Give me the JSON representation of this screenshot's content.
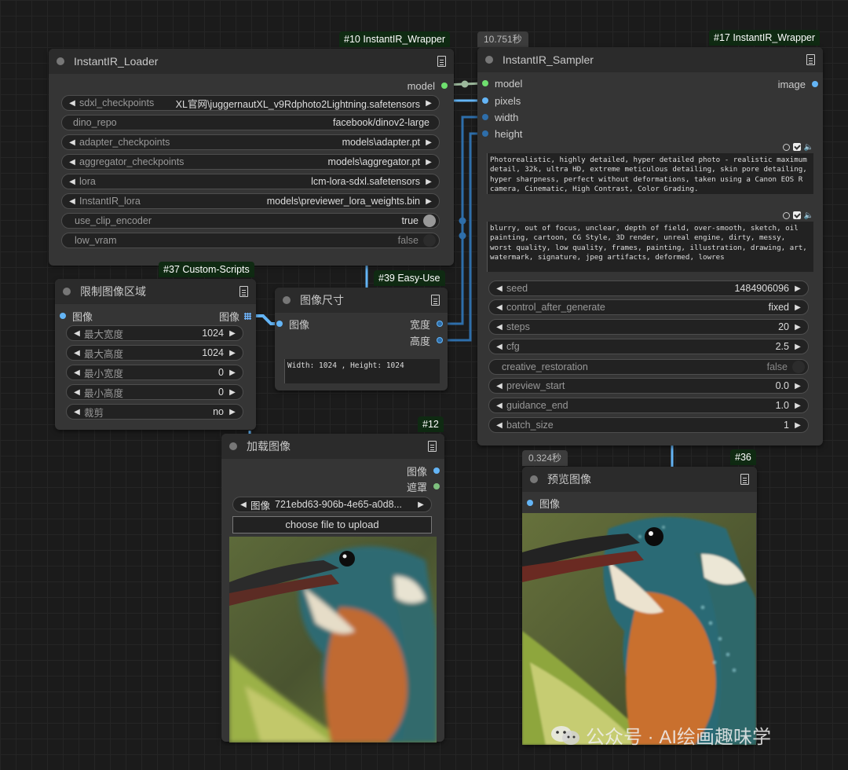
{
  "tags": {
    "loader": "#10 InstantIR_Wrapper",
    "sampler": "#17 InstantIR_Wrapper",
    "custom_scripts": "#37 Custom-Scripts",
    "easy_use": "#39 Easy-Use",
    "load_image": "#12",
    "preview": "#36"
  },
  "timings": {
    "sampler": "10.751秒",
    "preview": "0.324秒"
  },
  "loader": {
    "title": "InstantIR_Loader",
    "output_model": "model",
    "widgets": [
      {
        "label": "sdxl_checkpoints",
        "value": "XL官网\\juggernautXL_v9Rdphoto2Lightning.safetensors"
      },
      {
        "label": "dino_repo",
        "value": "facebook/dinov2-large"
      },
      {
        "label": "adapter_checkpoints",
        "value": "models\\adapter.pt"
      },
      {
        "label": "aggregator_checkpoints",
        "value": "models\\aggregator.pt"
      },
      {
        "label": "lora",
        "value": "lcm-lora-sdxl.safetensors"
      },
      {
        "label": "InstantIR_lora",
        "value": "models\\previewer_lora_weights.bin"
      },
      {
        "label": "use_clip_encoder",
        "value": "true"
      },
      {
        "label": "low_vram",
        "value": "false"
      }
    ]
  },
  "sampler": {
    "title": "InstantIR_Sampler",
    "inputs": [
      "model",
      "pixels",
      "width",
      "height"
    ],
    "output": "image",
    "positive_prompt": "Photorealistic, highly detailed, hyper detailed photo - realistic maximum detail, 32k, ultra HD, extreme meticulous detailing, skin pore detailing, hyper sharpness, perfect without deformations, taken using a Canon EOS R camera, Cinematic, High Contrast, Color Grading.",
    "negative_prompt": "blurry, out of focus, unclear, depth of field, over-smooth, sketch, oil painting, cartoon, CG Style, 3D render, unreal engine, dirty, messy, worst quality, low quality, frames, painting, illustration, drawing, art, watermark, signature, jpeg artifacts, deformed, lowres",
    "widgets": [
      {
        "label": "seed",
        "value": "1484906096"
      },
      {
        "label": "control_after_generate",
        "value": "fixed"
      },
      {
        "label": "steps",
        "value": "20"
      },
      {
        "label": "cfg",
        "value": "2.5"
      },
      {
        "label": "creative_restoration",
        "value": "false"
      },
      {
        "label": "preview_start",
        "value": "0.0"
      },
      {
        "label": "guidance_end",
        "value": "1.0"
      },
      {
        "label": "batch_size",
        "value": "1"
      }
    ]
  },
  "limit": {
    "title": "限制图像区域",
    "input": "图像",
    "output": "图像",
    "widgets": [
      {
        "label": "最大宽度",
        "value": "1024"
      },
      {
        "label": "最大高度",
        "value": "1024"
      },
      {
        "label": "最小宽度",
        "value": "0"
      },
      {
        "label": "最小高度",
        "value": "0"
      },
      {
        "label": "裁剪",
        "value": "no"
      }
    ]
  },
  "imgsize": {
    "title": "图像尺寸",
    "input": "图像",
    "outputs": [
      "宽度",
      "高度"
    ],
    "display": "Width: 1024 , Height: 1024"
  },
  "loadimg": {
    "title": "加载图像",
    "outputs": [
      "图像",
      "遮罩"
    ],
    "image_label": "图像",
    "image_value": "721ebd63-906b-4e65-a0d8...",
    "upload": "choose file to upload"
  },
  "preview": {
    "title": "预览图像",
    "input": "图像"
  },
  "watermark": "公众号 · AI绘画趣味学",
  "colors": {
    "image_link": "#64b5f6",
    "model_link": "#b5d3b5",
    "tag_bg": "#0f2a12"
  }
}
